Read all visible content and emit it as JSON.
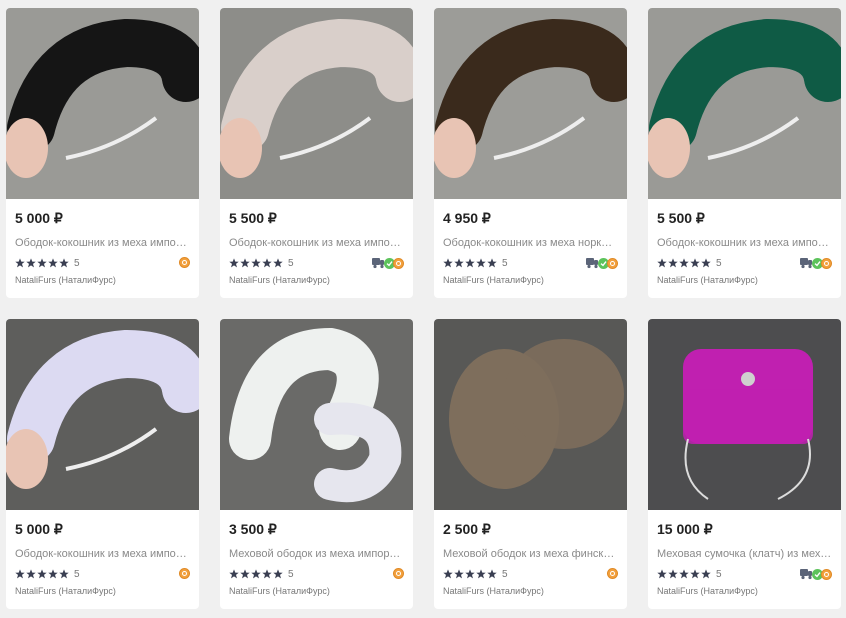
{
  "products": [
    {
      "price": "5 000 ₽",
      "title": "Ободок-кокошник из меха импор…",
      "rating": "5",
      "seller": "NataliFurs (НаталиФурс)",
      "badges": [
        "coin-icon"
      ],
      "fur_color": "#151515",
      "bg_color": "#9a9a96"
    },
    {
      "price": "5 500 ₽",
      "title": "Ободок-кокошник из меха импор…",
      "rating": "5",
      "seller": "NataliFurs (НаталиФурс)",
      "badges": [
        "delivery-icon",
        "check-icon",
        "coin-icon"
      ],
      "fur_color": "#d9cfca",
      "bg_color": "#8d8d89"
    },
    {
      "price": "4 950 ₽",
      "title": "Ободок-кокошник из меха норки …",
      "rating": "5",
      "seller": "NataliFurs (НаталиФурс)",
      "badges": [
        "delivery-icon",
        "check-icon",
        "coin-icon"
      ],
      "fur_color": "#3a2a1c",
      "bg_color": "#9c9c98"
    },
    {
      "price": "5 500 ₽",
      "title": "Ободок-кокошник из меха импор…",
      "rating": "5",
      "seller": "NataliFurs (НаталиФурс)",
      "badges": [
        "delivery-icon",
        "check-icon",
        "coin-icon"
      ],
      "fur_color": "#0f5b45",
      "bg_color": "#9a9a96"
    },
    {
      "price": "5 000 ₽",
      "title": "Ободок-кокошник из меха импор…",
      "rating": "5",
      "seller": "NataliFurs (НаталиФурс)",
      "badges": [
        "coin-icon"
      ],
      "fur_color": "#dcdaf2",
      "bg_color": "#5e5e5c"
    },
    {
      "price": "3 500 ₽",
      "title": "Меховой ободок из меха импорт…",
      "rating": "5",
      "seller": "NataliFurs (НаталиФурс)",
      "badges": [
        "coin-icon"
      ],
      "fur_color": "#eef1ef",
      "bg_color": "#6a6a68"
    },
    {
      "price": "2 500 ₽",
      "title": "Меховой ободок из меха финског…",
      "rating": "5",
      "seller": "NataliFurs (НаталиФурс)",
      "badges": [
        "coin-icon"
      ],
      "fur_color": "#7e6e5c",
      "bg_color": "#585856"
    },
    {
      "price": "15 000 ₽",
      "title": "Меховая сумочка (клатч) из меха…",
      "rating": "5",
      "seller": "NataliFurs (НаталиФурс)",
      "badges": [
        "delivery-icon",
        "check-icon",
        "coin-icon"
      ],
      "fur_color": "#c020b0",
      "bg_color": "#4d4d4f"
    }
  ],
  "colors": {
    "star": "#3a3f52",
    "check": "#5cc35b",
    "coin": "#f2a03d",
    "price": "#222222",
    "muted": "#8a8a8a"
  }
}
